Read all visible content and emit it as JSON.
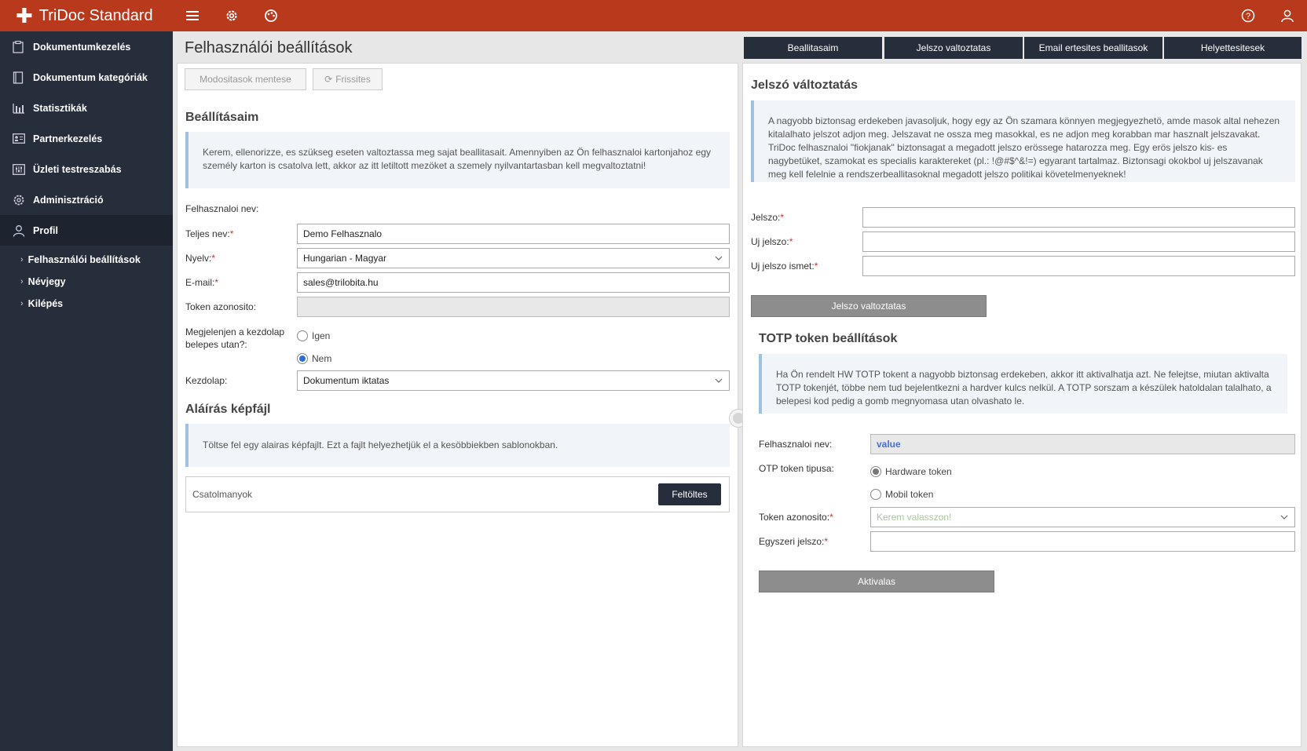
{
  "app": {
    "title": "TriDoc Standard",
    "accent": "#b8391c",
    "sidebar_bg": "#262d3b"
  },
  "topbar": {
    "menu_icon": "hamburger-icon",
    "settings_icon": "gear-icon",
    "dashboard_icon": "palette-icon",
    "help_icon": "help-icon",
    "user_icon": "user-icon"
  },
  "sidebar": {
    "items": [
      {
        "label": "Dokumentumkezelés",
        "icon": "clipboard-icon"
      },
      {
        "label": "Dokumentum kategóriák",
        "icon": "book-icon"
      },
      {
        "label": "Statisztikák",
        "icon": "bar-chart-icon"
      },
      {
        "label": "Partnerkezelés",
        "icon": "id-card-icon"
      },
      {
        "label": "Üzleti testreszabás",
        "icon": "sliders-icon"
      },
      {
        "label": "Adminisztráció",
        "icon": "gear-icon"
      },
      {
        "label": "Profil",
        "icon": "user-icon"
      }
    ],
    "subitems": [
      {
        "label": "Felhasználói beállítások"
      },
      {
        "label": "Névjegy"
      },
      {
        "label": "Kilépés"
      }
    ]
  },
  "left": {
    "page_title": "Felhasználói beállítások",
    "save_label": "Modositasok mentese",
    "refresh_label": "Frissites",
    "section_title": "Beállításaim",
    "info": "Kerem, ellenorizze, es szükseg eseten valtoztassa meg sajat beallitasait. Amennyiben az Ön felhasznaloi kartonjahoz egy személy karton is csatolva lett, akkor az itt letiltott mezöket a szemely nyilvantartasban kell megvaltoztatni!",
    "username_label": "Felhasznaloi nev:",
    "fullname_label": "Teljes nev:",
    "fullname_value": "Demo Felhasznalo",
    "language_label": "Nyelv:",
    "language_value": "Hungarian - Magyar",
    "email_label": "E-mail:",
    "email_value": "sales@trilobita.hu",
    "token_label": "Token azonosito:",
    "token_value": "",
    "homepage_question": "Megjelenjen a kezdolap belepes utan?:",
    "yes_label": "Igen",
    "no_label": "Nem",
    "homepage_label": "Kezdolap:",
    "homepage_value": "Dokumentum iktatas",
    "signature_title": "Aláírás képfájl",
    "signature_info": "Töltse fel egy alairas képfajlt. Ezt a fajlt helyezhetjük el a kesöbbiekben sablonokban.",
    "attachments_label": "Csatolmanyok",
    "upload_label": "Feltöltes"
  },
  "tabs": [
    "Beallitasaim",
    "Jelszo valtoztatas",
    "Email ertesites beallitasok",
    "Helyettesitesek"
  ],
  "right": {
    "password_title": "Jelszó változtatás",
    "password_info": "A nagyobb biztonsag erdekeben javasoljuk, hogy egy az Ön szamara könnyen megjegyezhetö, amde masok altal nehezen kitalalhato jelszot adjon meg. Jelszavat ne ossza meg masokkal, es ne adjon meg korabban mar hasznalt jelszavakat. TriDoc felhasznaloi \"fiokjanak\" biztonsagat a megadott jelszo erössege hatarozza meg. Egy erös jelszo kis- es nagybetüket, szamokat es specialis karaktereket (pl.: !@#$^&!=) egyarant tartalmaz. Biztonsagi okokbol uj jelszavanak meg kell felelnie a rendszerbeallitasoknal megadott jelszo politikai követelmenyeknek!",
    "password_label": "Jelszo:",
    "new_password_label": "Uj jelszo:",
    "repeat_password_label": "Uj jelszo ismet:",
    "change_button": "Jelszo valtoztatas",
    "totp_title": "TOTP token beállítások",
    "totp_info": "Ha Ön rendelt HW TOTP tokent a nagyobb biztonsag erdekeben, akkor itt aktivalhatja azt. Ne felejtse, miutan aktivalta TOTP tokenjét, többe nem tud bejelentkezni a hardver kulcs nelkül. A TOTP sorszam a készülek hatoldalan talalhato, a belepesi kod pedig a gomb megnyomasa utan olvashato le.",
    "username_label": "Felhasznaloi nev:",
    "username_value": "value",
    "otp_type_label": "OTP token tipusa:",
    "hardware_label": "Hardware token",
    "mobile_label": "Mobil token",
    "token_id_label": "Token azonosito:",
    "token_placeholder": "Kerem valasszon!",
    "otp_label": "Egyszeri jelszo:",
    "activate_button": "Aktivalas"
  }
}
